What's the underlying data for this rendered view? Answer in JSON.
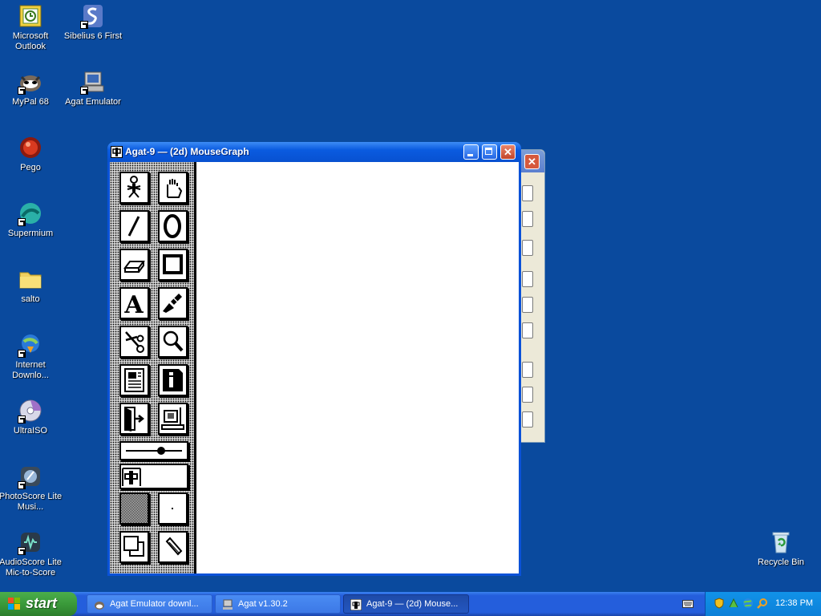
{
  "desktop": {
    "icons": [
      {
        "label": "Microsoft Outlook",
        "icon": "outlook-icon"
      },
      {
        "label": "Sibelius 6 First",
        "icon": "sibelius-icon"
      },
      {
        "label": "MyPal 68",
        "icon": "mypal-icon"
      },
      {
        "label": "Agat Emulator",
        "icon": "agat-emulator-icon"
      },
      {
        "label": "Pego",
        "icon": "pego-icon"
      },
      {
        "label": "Supermium",
        "icon": "supermium-icon"
      },
      {
        "label": "salto",
        "icon": "folder-icon"
      },
      {
        "label": "Internet Downlo...",
        "icon": "internet-download-icon"
      },
      {
        "label": "UltraISO",
        "icon": "ultraiso-icon"
      },
      {
        "label": "PhotoScore Lite Musi...",
        "icon": "photoscore-icon"
      },
      {
        "label": "AudioScore Lite Mic-to-Score",
        "icon": "audioscore-icon"
      },
      {
        "label": "Recycle Bin",
        "icon": "recycle-bin-icon"
      }
    ]
  },
  "window": {
    "title": "Agat-9 — (2d) MouseGraph",
    "tools": [
      "skeleton-icon",
      "hand-icon",
      "line-icon",
      "ellipse-icon",
      "eraser-icon",
      "rectangle-icon",
      "text-icon",
      "brush-icon",
      "scissors-icon",
      "magnifier-icon",
      "document-icon",
      "info-icon",
      "exit-icon",
      "printer-icon",
      "slider-icon",
      "font-icon",
      "pattern-icon",
      "pen-size-icon",
      "copy-icon",
      "pencil-icon"
    ]
  },
  "taskbar": {
    "start_label": "start",
    "tasks": [
      {
        "label": "Agat Emulator downl...",
        "active": false
      },
      {
        "label": "Agat v1.30.2",
        "active": false
      },
      {
        "label": "Agat-9 — (2d) Mouse...",
        "active": true
      }
    ],
    "clock": "12:38 PM"
  },
  "colors": {
    "desktop": "#0a4a9e",
    "titlebar": "#0a5be0",
    "start": "#3a9a3a"
  }
}
